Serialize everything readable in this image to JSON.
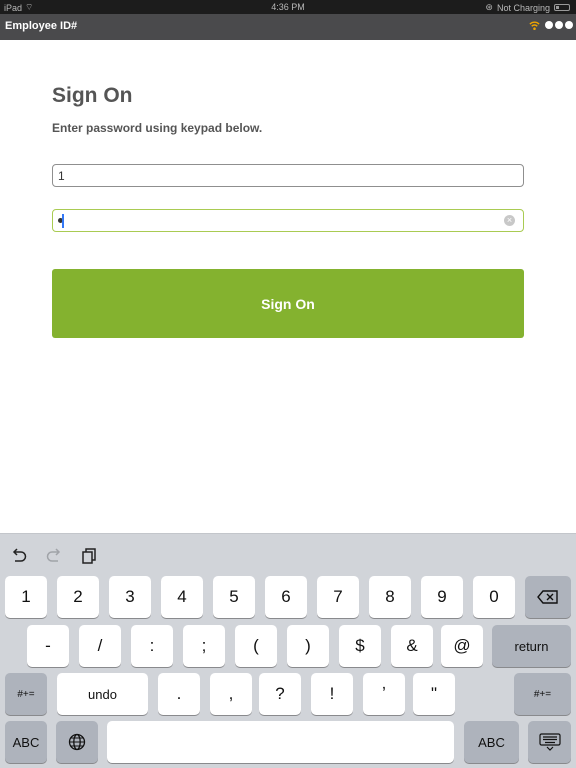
{
  "status_bar": {
    "device": "iPad",
    "time": "4:36 PM",
    "charging": "Not Charging"
  },
  "app_header": {
    "title": "Employee ID#"
  },
  "sign_on": {
    "title": "Sign On",
    "instruction": "Enter password using keypad below.",
    "employee_id_value": "1",
    "password_masked": true,
    "button_label": "Sign On",
    "accent_color": "#84b22f"
  },
  "keyboard": {
    "tools": [
      "undo-icon",
      "redo-icon",
      "paste-icon"
    ],
    "row1": [
      "1",
      "2",
      "3",
      "4",
      "5",
      "6",
      "7",
      "8",
      "9",
      "0"
    ],
    "row2": [
      "-",
      "/",
      ":",
      ";",
      "(",
      ")",
      "$",
      "&",
      "@"
    ],
    "row2_return": "return",
    "row3_left": "#+=",
    "row3_undo": "undo",
    "row3": [
      ".",
      ",",
      "?",
      "!",
      "ʼ",
      "ʺ"
    ],
    "row3_right": "#+=",
    "row4_abc_left": "ABC",
    "row4_abc_right": "ABC"
  }
}
